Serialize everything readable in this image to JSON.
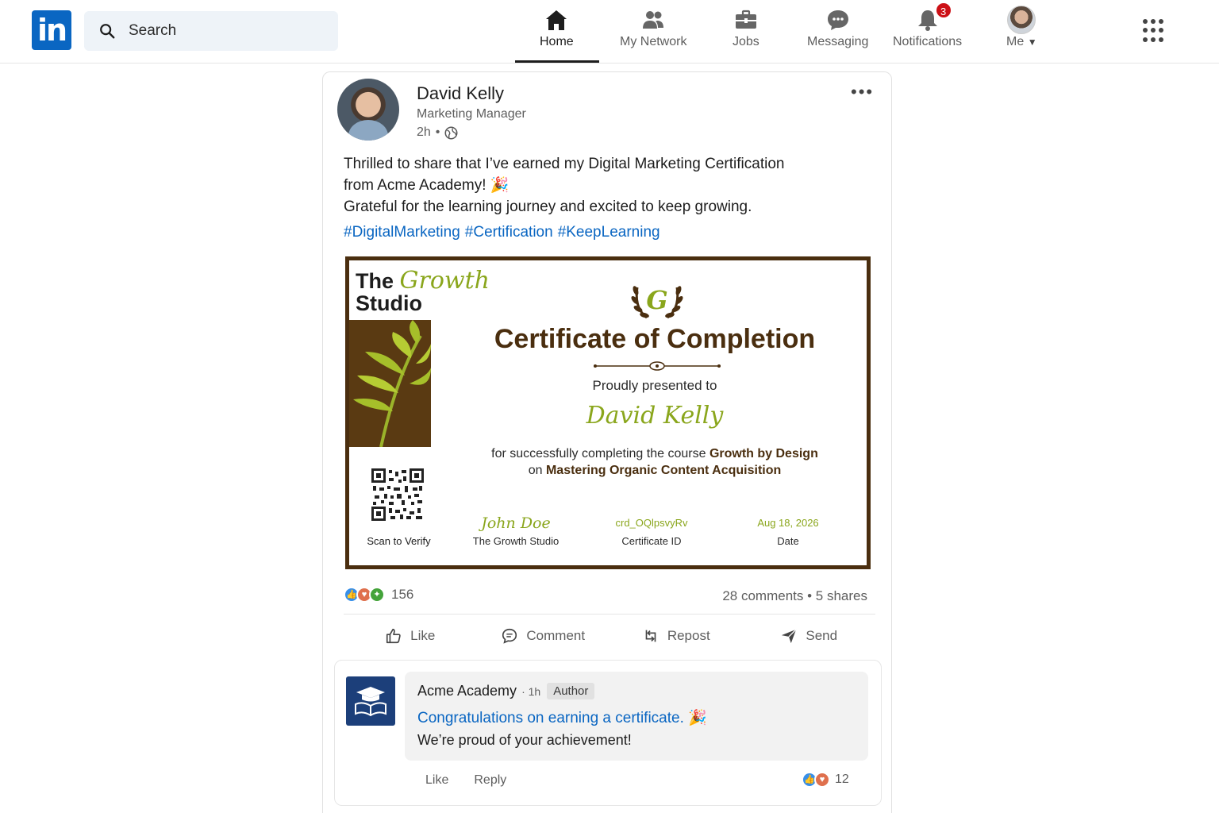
{
  "colors": {
    "linkedin_blue": "#0a66c2",
    "cert_brown": "#4a2e0f",
    "cert_green": "#8aa61c",
    "badge_red": "#cc1016"
  },
  "nav": {
    "logo_text": "in",
    "search_placeholder": "Search",
    "items": [
      {
        "label": "Home",
        "icon": "home-icon",
        "active": true
      },
      {
        "label": "My Network",
        "icon": "network-icon"
      },
      {
        "label": "Jobs",
        "icon": "briefcase-icon"
      },
      {
        "label": "Messaging",
        "icon": "chat-icon"
      },
      {
        "label": "Notifications",
        "icon": "bell-icon",
        "badge": "3"
      },
      {
        "label": "Me",
        "icon": "avatar"
      }
    ]
  },
  "post": {
    "author": "David Kelly",
    "title": "Marketing Manager",
    "time": "2h",
    "text_line1": "Thrilled to share that I’ve earned my Digital Marketing Certification",
    "text_line2": "from Acme Academy! 🎉",
    "text_line3": "Grateful for the learning journey and excited to keep growing.",
    "hashtags": [
      "#DigitalMarketing",
      "#Certification",
      "#KeepLearning"
    ],
    "certificate": {
      "brand_the": "The",
      "brand_growth": "Growth",
      "brand_studio": "Studio",
      "title": "Certificate of Completion",
      "presented": "Proudly presented to",
      "recipient": "David Kelly",
      "course_prefix": "for successfully completing the course",
      "course_name": "Growth by Design",
      "course_on": "on",
      "course_topic": "Mastering Organic Content Acquisition",
      "scan": "Scan to Verify",
      "signature": "John Doe",
      "signature_label": "The Growth Studio",
      "cert_id": "crd_OQlpsvyRv",
      "cert_id_label": "Certificate ID",
      "date": "Aug 18, 2026",
      "date_label": "Date"
    },
    "reactions_count": "156",
    "comments": "28 comments",
    "shares": "5 shares",
    "actions": {
      "like": "Like",
      "comment": "Comment",
      "repost": "Repost",
      "send": "Send"
    }
  },
  "comment": {
    "author": "Acme Academy",
    "time": "· 1h",
    "badge": "Author",
    "line1": "Congratulations on earning a certificate. 🎉",
    "line2": "We’re proud of your achievement!",
    "like": "Like",
    "reply": "Reply",
    "reactions_count": "12"
  }
}
